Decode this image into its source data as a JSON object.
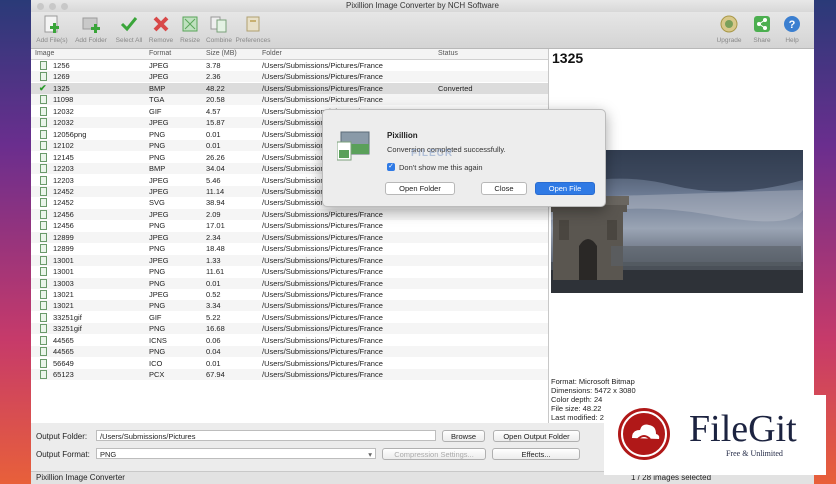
{
  "window": {
    "title": "Pixillion Image Converter by NCH Software"
  },
  "toolbar": {
    "left": [
      {
        "label": "Add File(s)",
        "icon": "add-file-icon"
      },
      {
        "label": "Add Folder",
        "icon": "add-folder-icon"
      },
      {
        "label": "Select All",
        "icon": "select-all-icon"
      },
      {
        "label": "Remove",
        "icon": "remove-icon"
      },
      {
        "label": "Resize",
        "icon": "resize-icon"
      },
      {
        "label": "Combine",
        "icon": "combine-icon"
      },
      {
        "label": "Preferences",
        "icon": "preferences-icon"
      }
    ],
    "right": [
      {
        "label": "Upgrade",
        "icon": "upgrade-icon"
      },
      {
        "label": "Share",
        "icon": "share-icon"
      },
      {
        "label": "Help",
        "icon": "help-icon"
      }
    ]
  },
  "list": {
    "columns": [
      "Image",
      "Format",
      "Size (MB)",
      "Folder",
      "Status"
    ],
    "rows": [
      {
        "name": "1256",
        "format": "JPEG",
        "size": "3.78",
        "folder": "/Users/Submissions/Pictures/France",
        "status": ""
      },
      {
        "name": "1269",
        "format": "JPEG",
        "size": "2.36",
        "folder": "/Users/Submissions/Pictures/France",
        "status": ""
      },
      {
        "name": "1325",
        "format": "BMP",
        "size": "48.22",
        "folder": "/Users/Submissions/Pictures/France",
        "status": "Converted"
      },
      {
        "name": "11098",
        "format": "TGA",
        "size": "20.58",
        "folder": "/Users/Submissions/Pictures/France",
        "status": ""
      },
      {
        "name": "12032",
        "format": "GIF",
        "size": "4.57",
        "folder": "/Users/Submissions/Pictures/France",
        "status": ""
      },
      {
        "name": "12032",
        "format": "JPEG",
        "size": "15.87",
        "folder": "/Users/Submissions/Pictures/France",
        "status": ""
      },
      {
        "name": "12056png",
        "format": "PNG",
        "size": "0.01",
        "folder": "/Users/Submissions/Pictures/France",
        "status": ""
      },
      {
        "name": "12102",
        "format": "PNG",
        "size": "0.01",
        "folder": "/Users/Submissions/Pictures/France",
        "status": ""
      },
      {
        "name": "12145",
        "format": "PNG",
        "size": "26.26",
        "folder": "/Users/Submissions/Pictures/France",
        "status": ""
      },
      {
        "name": "12203",
        "format": "BMP",
        "size": "34.04",
        "folder": "/Users/Submissions/Pictures/France",
        "status": ""
      },
      {
        "name": "12203",
        "format": "JPEG",
        "size": "5.46",
        "folder": "/Users/Submissions/Pictures/France",
        "status": ""
      },
      {
        "name": "12452",
        "format": "JPEG",
        "size": "11.14",
        "folder": "/Users/Submissions/Pictures/France",
        "status": ""
      },
      {
        "name": "12452",
        "format": "SVG",
        "size": "38.94",
        "folder": "/Users/Submissions/Pictures/France",
        "status": ""
      },
      {
        "name": "12456",
        "format": "JPEG",
        "size": "2.09",
        "folder": "/Users/Submissions/Pictures/France",
        "status": ""
      },
      {
        "name": "12456",
        "format": "PNG",
        "size": "17.01",
        "folder": "/Users/Submissions/Pictures/France",
        "status": ""
      },
      {
        "name": "12899",
        "format": "JPEG",
        "size": "2.34",
        "folder": "/Users/Submissions/Pictures/France",
        "status": ""
      },
      {
        "name": "12899",
        "format": "PNG",
        "size": "18.48",
        "folder": "/Users/Submissions/Pictures/France",
        "status": ""
      },
      {
        "name": "13001",
        "format": "JPEG",
        "size": "1.33",
        "folder": "/Users/Submissions/Pictures/France",
        "status": ""
      },
      {
        "name": "13001",
        "format": "PNG",
        "size": "11.61",
        "folder": "/Users/Submissions/Pictures/France",
        "status": ""
      },
      {
        "name": "13003",
        "format": "PNG",
        "size": "0.01",
        "folder": "/Users/Submissions/Pictures/France",
        "status": ""
      },
      {
        "name": "13021",
        "format": "JPEG",
        "size": "0.52",
        "folder": "/Users/Submissions/Pictures/France",
        "status": ""
      },
      {
        "name": "13021",
        "format": "PNG",
        "size": "3.34",
        "folder": "/Users/Submissions/Pictures/France",
        "status": ""
      },
      {
        "name": "33251gif",
        "format": "GIF",
        "size": "5.22",
        "folder": "/Users/Submissions/Pictures/France",
        "status": ""
      },
      {
        "name": "33251gif",
        "format": "PNG",
        "size": "16.68",
        "folder": "/Users/Submissions/Pictures/France",
        "status": ""
      },
      {
        "name": "44565",
        "format": "ICNS",
        "size": "0.06",
        "folder": "/Users/Submissions/Pictures/France",
        "status": ""
      },
      {
        "name": "44565",
        "format": "PNG",
        "size": "0.04",
        "folder": "/Users/Submissions/Pictures/France",
        "status": ""
      },
      {
        "name": "56649",
        "format": "ICO",
        "size": "0.01",
        "folder": "/Users/Submissions/Pictures/France",
        "status": ""
      },
      {
        "name": "65123",
        "format": "PCX",
        "size": "67.94",
        "folder": "/Users/Submissions/Pictures/France",
        "status": ""
      }
    ]
  },
  "preview": {
    "title": "1325",
    "info": [
      "Format: Microsoft Bitmap",
      "Dimensions: 5472 x 3080",
      "Color depth: 24",
      "File size: 48.22",
      "Last modified: 2"
    ]
  },
  "bottom": {
    "output_folder_label": "Output Folder:",
    "output_folder_value": "/Users/Submissions/Pictures",
    "browse": "Browse",
    "open_output_folder": "Open Output Folder",
    "output_format_label": "Output Format:",
    "output_format_value": "PNG",
    "compression_settings": "Compression Settings...",
    "effects": "Effects..."
  },
  "status": {
    "app": "Pixillion Image Converter",
    "selection": "1 / 28 images selected"
  },
  "dialog": {
    "title": "Pixillion",
    "message": "Conversion completed successfully.",
    "checkbox": "Don't show me this again",
    "open_folder": "Open Folder",
    "close": "Close",
    "open_file": "Open File"
  },
  "watermark": {
    "filecr": "FILECR",
    "brand": "FileGit",
    "tagline": "Free & Unlimited"
  },
  "colors": {
    "accent": "#2f7ae5",
    "converted_check": "#2a9a2a",
    "brand_red": "#b01818"
  }
}
